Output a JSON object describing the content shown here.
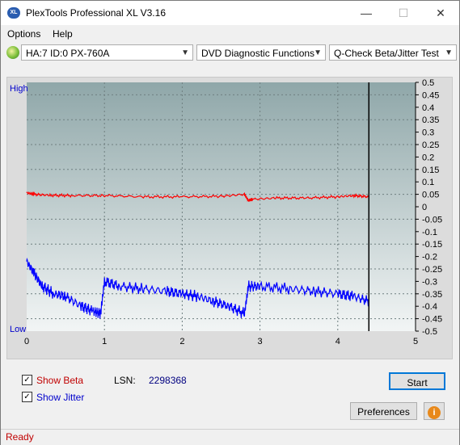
{
  "window": {
    "title": "PlexTools Professional XL V3.16",
    "icon_label": "XL",
    "minimize_glyph": "—",
    "maximize_glyph": "☐",
    "close_glyph": "✕"
  },
  "menu": {
    "options": "Options",
    "help": "Help"
  },
  "toolbar": {
    "drive": "HA:7 ID:0  PX-760A",
    "function": "DVD Diagnostic Functions",
    "test": "Q-Check Beta/Jitter Test"
  },
  "chart_data": {
    "type": "line",
    "y_left_labels": {
      "high": "High",
      "low": "Low"
    },
    "x_ticks": [
      "0",
      "1",
      "2",
      "3",
      "4",
      "5"
    ],
    "xlim": [
      0,
      5
    ],
    "y_right_ticks": [
      "0.5",
      "0.45",
      "0.4",
      "0.35",
      "0.3",
      "0.25",
      "0.2",
      "0.15",
      "0.1",
      "0.05",
      "0",
      "-0.05",
      "-0.1",
      "-0.15",
      "-0.2",
      "-0.25",
      "-0.3",
      "-0.35",
      "-0.4",
      "-0.45",
      "-0.5"
    ],
    "ylim": [
      -0.5,
      0.5
    ],
    "grid": true,
    "end_marker_x": 4.4,
    "colors": {
      "beta": "#ff0000",
      "jitter": "#0000ff",
      "marker": "#000000"
    },
    "series": [
      {
        "key": "beta",
        "x": [
          0,
          0.1,
          0.3,
          0.6,
          1.0,
          1.5,
          2.0,
          2.5,
          2.8,
          2.85,
          2.9,
          3.2,
          3.6,
          4.0,
          4.2,
          4.4
        ],
        "values": [
          0.056,
          0.05,
          0.046,
          0.045,
          0.045,
          0.04,
          0.04,
          0.042,
          0.05,
          0.025,
          0.03,
          0.035,
          0.035,
          0.04,
          0.045,
          0.04
        ]
      },
      {
        "key": "jitter",
        "x": [
          0,
          0.1,
          0.2,
          0.35,
          0.5,
          0.7,
          0.85,
          0.95,
          1.0,
          1.2,
          1.5,
          1.8,
          2.0,
          2.2,
          2.4,
          2.6,
          2.8,
          2.85,
          3.0,
          3.4,
          3.7,
          4.0,
          4.2,
          4.4
        ],
        "values": [
          -0.22,
          -0.27,
          -0.32,
          -0.35,
          -0.36,
          -0.4,
          -0.42,
          -0.43,
          -0.3,
          -0.32,
          -0.33,
          -0.34,
          -0.35,
          -0.36,
          -0.38,
          -0.4,
          -0.43,
          -0.32,
          -0.32,
          -0.33,
          -0.34,
          -0.35,
          -0.36,
          -0.38
        ]
      }
    ]
  },
  "controls": {
    "show_beta": "Show Beta",
    "show_jitter": "Show Jitter",
    "lsn_label": "LSN:",
    "lsn_value": "2298368",
    "start": "Start",
    "preferences": "Preferences",
    "info_glyph": "i",
    "check_glyph": "✓"
  },
  "status": {
    "text": "Ready"
  }
}
